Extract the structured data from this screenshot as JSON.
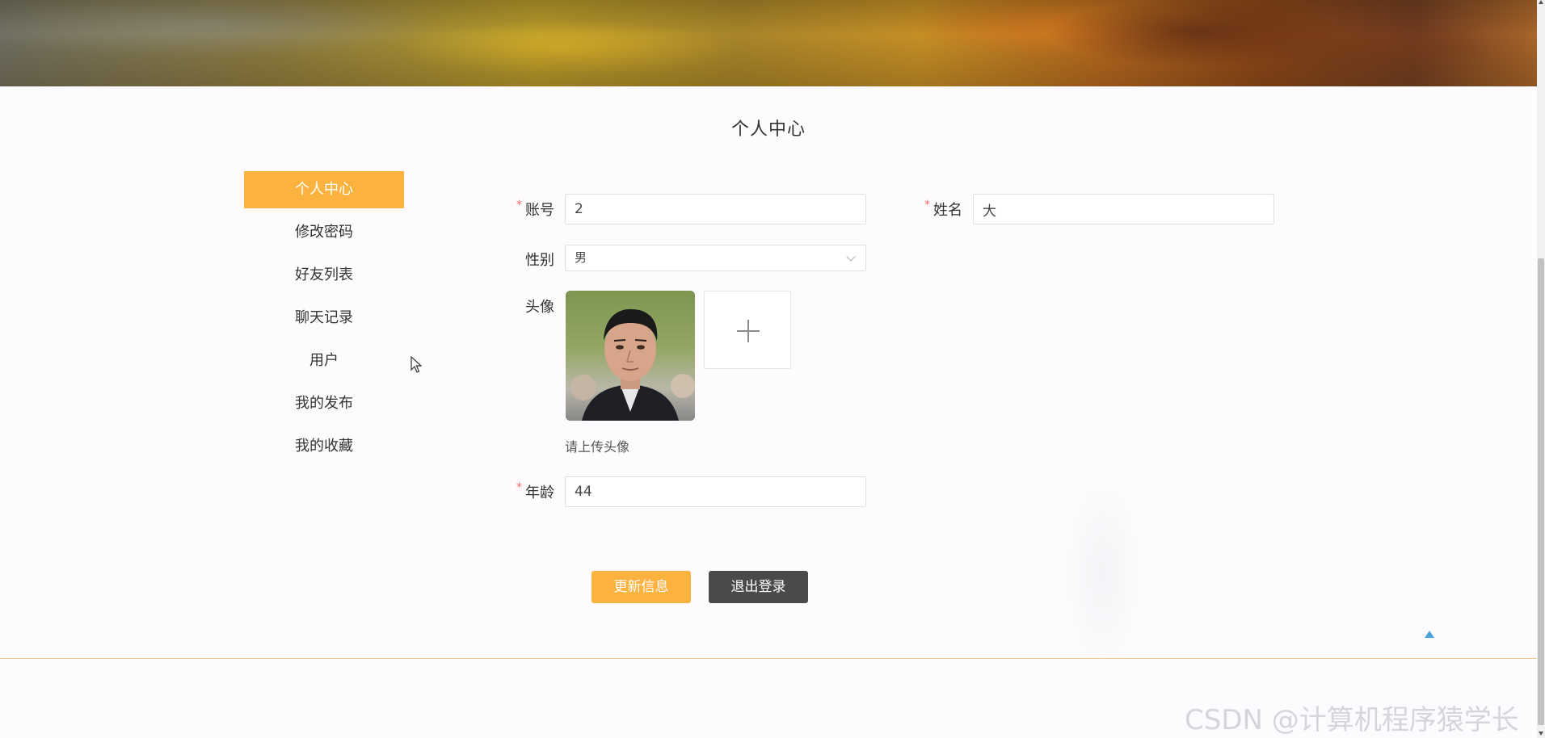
{
  "page": {
    "title": "个人中心"
  },
  "side_menu": {
    "items": [
      {
        "label": "个人中心",
        "active": true
      },
      {
        "label": "修改密码",
        "active": false
      },
      {
        "label": "好友列表",
        "active": false
      },
      {
        "label": "聊天记录",
        "active": false
      },
      {
        "label": "用户",
        "active": false
      },
      {
        "label": "我的发布",
        "active": false
      },
      {
        "label": "我的收藏",
        "active": false
      }
    ]
  },
  "form": {
    "account": {
      "label": "账号",
      "required": true,
      "value": "2"
    },
    "name": {
      "label": "姓名",
      "required": true,
      "value": "大"
    },
    "gender": {
      "label": "性别",
      "required": false,
      "value": "男"
    },
    "avatar": {
      "label": "头像",
      "required": false,
      "hint": "请上传头像"
    },
    "age": {
      "label": "年龄",
      "required": true,
      "value": "44"
    },
    "required_mark": "*"
  },
  "buttons": {
    "update": "更新信息",
    "logout": "退出登录"
  },
  "watermark": "CSDN @计算机程序猿学长",
  "icons": {
    "upload": "plus-icon",
    "select": "chevron-down-icon",
    "back_to_top": "triangle-up-icon",
    "cursor": "mouse-pointer-icon"
  },
  "colors": {
    "accent": "#fbb23f",
    "dark_button": "#4a4a4a",
    "required": "#f56c6c",
    "back_to_top": "#4aa3df",
    "footer_line": "#f1c98a"
  }
}
